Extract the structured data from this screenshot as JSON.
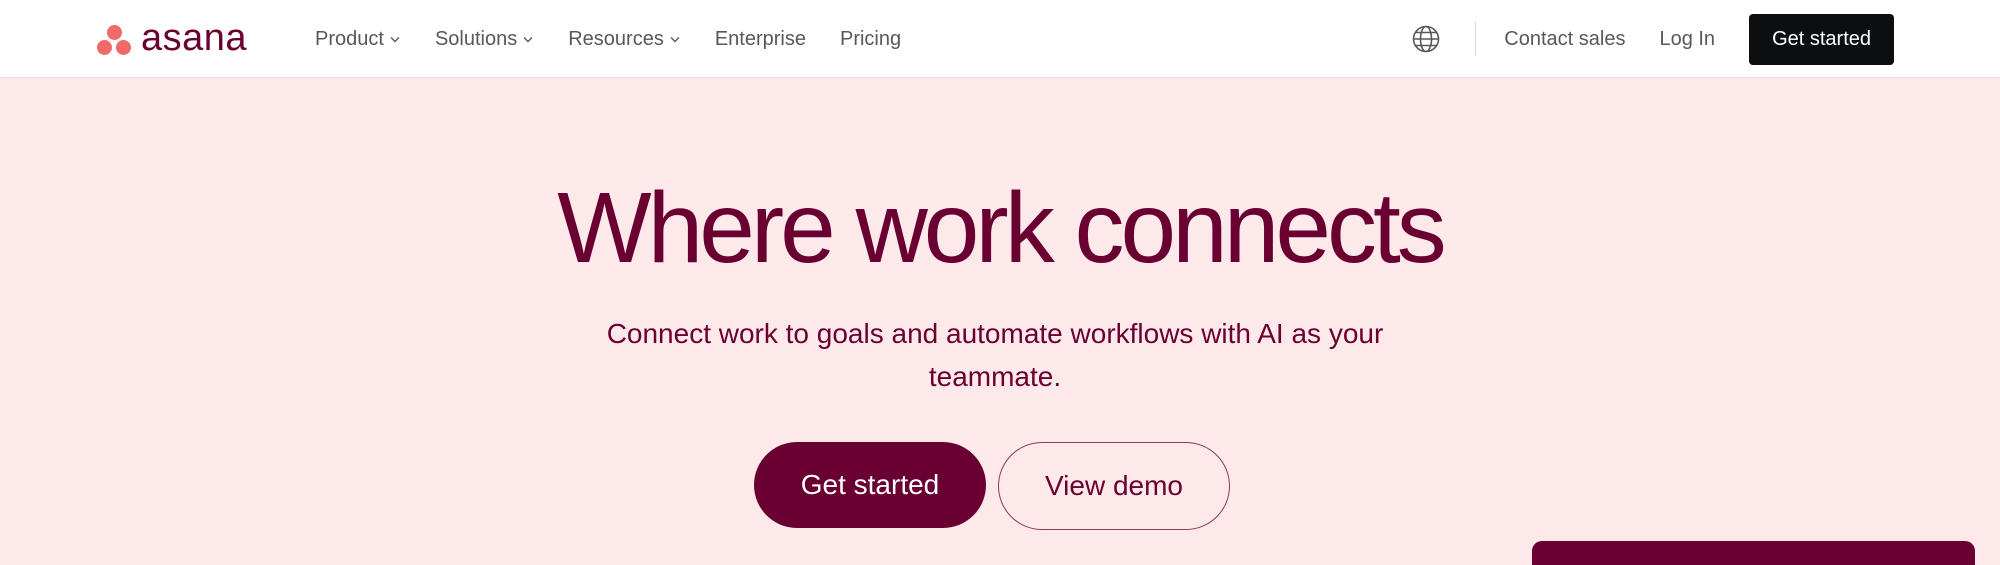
{
  "brand": {
    "name": "asana",
    "logo_color": "#f06a6a",
    "primary": "#690031"
  },
  "nav": {
    "items": [
      {
        "label": "Product",
        "has_dropdown": true
      },
      {
        "label": "Solutions",
        "has_dropdown": true
      },
      {
        "label": "Resources",
        "has_dropdown": true
      },
      {
        "label": "Enterprise",
        "has_dropdown": false
      },
      {
        "label": "Pricing",
        "has_dropdown": false
      }
    ],
    "language_icon": "globe-icon",
    "contact_sales": "Contact sales",
    "log_in": "Log In",
    "get_started": "Get started"
  },
  "hero": {
    "title": "Where work connects",
    "subtitle": "Connect work to goals and automate workflows with AI as your teammate.",
    "primary_cta": "Get started",
    "secondary_cta": "View demo",
    "background": "#fde8ea"
  }
}
